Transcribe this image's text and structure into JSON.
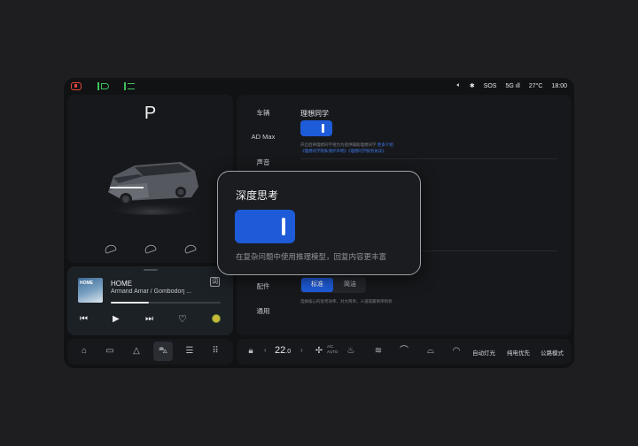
{
  "status_bar": {
    "volume_icon": "speaker-icon",
    "bluetooth_icon": "bluetooth-icon",
    "sos": "SOS",
    "network": "5G",
    "temperature": "27°C",
    "time": "18:00"
  },
  "car": {
    "gear": "P"
  },
  "music": {
    "album_art_text": "HOME",
    "song": "HOME",
    "artist": "Armand Amar / Gombodorj ...",
    "lyrics_label": "词",
    "progress": 0.35
  },
  "settings": {
    "nav": [
      "车辆",
      "AD Max",
      "声音",
      "配件",
      "通用"
    ],
    "section_title": "理想同学",
    "toggle_on": true,
    "desc_plain": "开启后将理想同学视为为提供辅助理想同学 ",
    "desc_link1": "更多介绍",
    "desc_link2": "《理想同学隐私保护声明》《理想同学服务协议》",
    "seg_options": [
      "标准",
      "简洁"
    ],
    "seg_desc": "选择核心的思考效率，对大简单，人道取最简单和状"
  },
  "popup": {
    "title": "深度思考",
    "toggle_on": true,
    "description": "在复杂问题中使用推理模型，回复内容更丰富"
  },
  "dock_right": {
    "temperature": "22",
    "temperature_decimal": ".0",
    "ac_label": "A/C",
    "auto_label": "AUTO",
    "light_auto": "自动灯光",
    "ev_priority": "纯电优先",
    "road_mode": "公路模式"
  },
  "colors": {
    "accent": "#1e5bd8",
    "link": "#3d7bf0",
    "screen_bg": "#111214",
    "page_bg": "#1e1e21"
  }
}
